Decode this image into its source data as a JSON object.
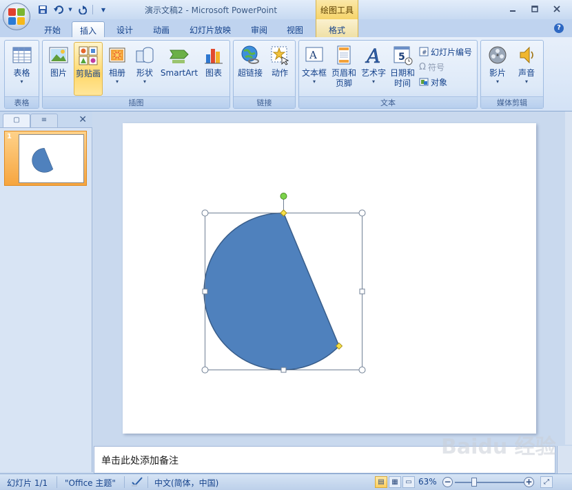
{
  "window": {
    "title": "演示文稿2 - Microsoft PowerPoint",
    "context_tool_title": "绘图工具",
    "min_icon": "minimize-icon",
    "max_icon": "maximize-icon",
    "close_icon": "close-icon"
  },
  "tabs": [
    {
      "label": "开始"
    },
    {
      "label": "插入",
      "active": true
    },
    {
      "label": "设计"
    },
    {
      "label": "动画"
    },
    {
      "label": "幻灯片放映"
    },
    {
      "label": "审阅"
    },
    {
      "label": "视图"
    },
    {
      "label": "格式",
      "contextual": true
    }
  ],
  "ribbon": {
    "groups": {
      "table": {
        "label": "表格",
        "buttons": [
          {
            "label": "表格",
            "icon": "table-icon"
          }
        ]
      },
      "illustrations": {
        "label": "插图",
        "buttons": [
          {
            "label": "图片",
            "icon": "picture-icon"
          },
          {
            "label": "剪贴画",
            "icon": "clipart-icon",
            "active": true
          },
          {
            "label": "相册",
            "icon": "photo-album-icon"
          },
          {
            "label": "形状",
            "icon": "shapes-icon"
          },
          {
            "label": "SmartArt",
            "icon": "smartart-icon"
          },
          {
            "label": "图表",
            "icon": "chart-icon"
          }
        ]
      },
      "links": {
        "label": "链接",
        "buttons": [
          {
            "label": "超链接",
            "icon": "hyperlink-icon"
          },
          {
            "label": "动作",
            "icon": "action-icon"
          }
        ]
      },
      "text": {
        "label": "文本",
        "buttons": [
          {
            "label": "文本框",
            "icon": "textbox-icon"
          },
          {
            "label": "页眉和",
            "label2": "页脚",
            "icon": "header-footer-icon"
          },
          {
            "label": "艺术字",
            "icon": "wordart-icon"
          },
          {
            "label": "日期和",
            "label2": "时间",
            "icon": "date-time-icon",
            "icon_text": "5"
          }
        ],
        "small_buttons": [
          {
            "label": "幻灯片编号",
            "icon": "slide-number-icon"
          },
          {
            "label": "符号",
            "icon": "symbol-icon",
            "icon_text": "Ω",
            "disabled": true
          },
          {
            "label": "对象",
            "icon": "object-icon"
          }
        ]
      },
      "media": {
        "label": "媒体剪辑",
        "buttons": [
          {
            "label": "影片",
            "icon": "movie-icon"
          },
          {
            "label": "声音",
            "icon": "sound-icon"
          }
        ]
      }
    }
  },
  "slides_pane": {
    "tab_icons": [
      "slides-tab-icon",
      "outline-tab-icon"
    ],
    "close_icon": "close-icon",
    "thumbnails": [
      {
        "number": "1"
      }
    ]
  },
  "slide": {
    "shape": "partial-circle (pie)",
    "fill_color": "#4f81bd",
    "stroke_color": "#385d8a"
  },
  "notes": {
    "placeholder": "单击此处添加备注"
  },
  "status_bar": {
    "slide_info": "幻灯片 1/1",
    "theme": "\"Office 主题\"",
    "language": "中文(简体，中国)",
    "zoom": "63%",
    "zoom_level_percent": 63
  },
  "watermark": "Baidu 经验"
}
